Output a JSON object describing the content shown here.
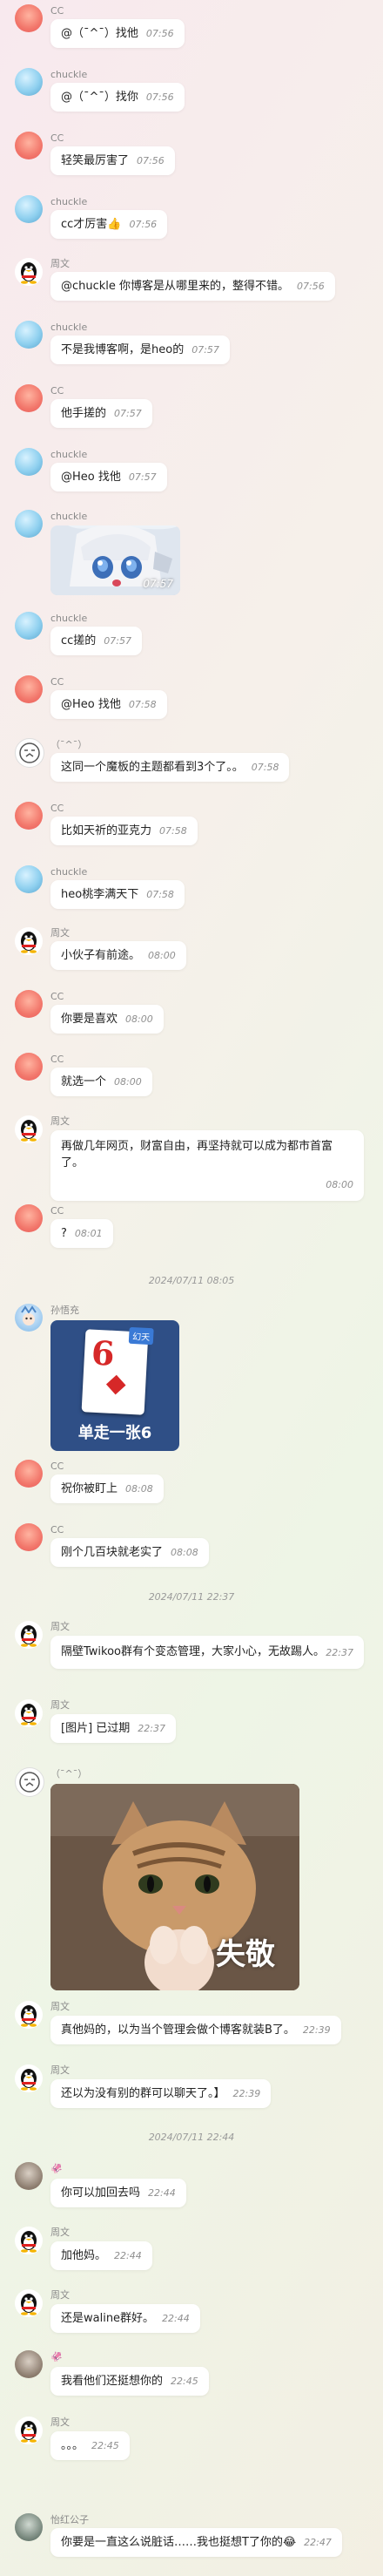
{
  "messages": [
    {
      "name": "CC",
      "text": "@（ˉ^ˉ）找他",
      "time": "07:56"
    },
    {
      "name": "chuckle",
      "text": "@（ˉ^ˉ）找你",
      "time": "07:56"
    },
    {
      "name": "CC",
      "text": "轻笑最厉害了",
      "time": "07:56"
    },
    {
      "name": "chuckle",
      "text": "cc才厉害👍",
      "time": "07:56"
    },
    {
      "name": "周文",
      "text": "@chuckle 你博客是从哪里来的，整得不错。",
      "time": "07:56"
    },
    {
      "name": "chuckle",
      "text": "不是我博客啊，是heo的",
      "time": "07:57"
    },
    {
      "name": "CC",
      "text": "他手搓的",
      "time": "07:57"
    },
    {
      "name": "chuckle",
      "text": "@Heo 找他",
      "time": "07:57"
    },
    {
      "name": "chuckle",
      "image": "anime-girl-sticker",
      "time": "07:57"
    },
    {
      "name": "chuckle",
      "text": "cc搓的",
      "time": "07:57"
    },
    {
      "name": "CC",
      "text": "@Heo 找他",
      "time": "07:58"
    },
    {
      "name": "（ˉ^ˉ）",
      "text": "这同一个魔板的主题都看到3个了。。",
      "time": "07:58"
    },
    {
      "name": "CC",
      "text": "比如天祈的亚克力",
      "time": "07:58"
    },
    {
      "name": "chuckle",
      "text": "heo桃李满天下",
      "time": "07:58"
    },
    {
      "name": "周文",
      "text": "小伙子有前途。",
      "time": "08:00"
    },
    {
      "name": "CC",
      "text": "你要是喜欢",
      "time": "08:00"
    },
    {
      "name": "CC",
      "text": "就选一个",
      "time": "08:00"
    },
    {
      "name": "周文",
      "text": "再做几年网页，财富自由，再坚持就可以成为都市首富了。",
      "time": "08:00"
    },
    {
      "name": "CC",
      "text": "?",
      "time": "08:01"
    },
    {
      "divider": "2024/07/11 08:05"
    },
    {
      "name": "孙悟充",
      "image": "card",
      "card_text": "单走一张6",
      "card_number": "6",
      "card_tag": "幻天"
    },
    {
      "name": "CC",
      "text": "祝你被盯上",
      "time": "08:08"
    },
    {
      "name": "CC",
      "text": "刚个几百块就老实了",
      "time": "08:08"
    },
    {
      "divider": "2024/07/11 22:37"
    },
    {
      "name": "周文",
      "text": "隔壁Twikoo群有个变态管理，大家小心，无故踢人。",
      "time": "22:37"
    },
    {
      "name": "周文",
      "text": "[图片] 已过期",
      "time": "22:37"
    },
    {
      "name": "（ˉ^ˉ）",
      "image": "cat-salute",
      "caption": "失敬"
    },
    {
      "name": "周文",
      "text": "真他妈的，以为当个管理会做个博客就装B了。",
      "time": "22:39"
    },
    {
      "name": "周文",
      "text": "还以为没有别的群可以聊天了。】",
      "time": "22:39"
    },
    {
      "divider": "2024/07/11 22:44"
    },
    {
      "name": "🦑",
      "text": "你可以加回去吗",
      "time": "22:44"
    },
    {
      "name": "周文",
      "text": "加他妈。",
      "time": "22:44"
    },
    {
      "name": "周文",
      "text": "还是waline群好。",
      "time": "22:44"
    },
    {
      "name": "🦑",
      "text": "我看他们还挺想你的",
      "time": "22:45"
    },
    {
      "name": "周文",
      "text": "。。。",
      "time": "22:45"
    },
    {
      "name": "怡红公子",
      "text": "你要是一直这么说脏话……我也挺想T了你的😂",
      "time": "22:47"
    }
  ]
}
